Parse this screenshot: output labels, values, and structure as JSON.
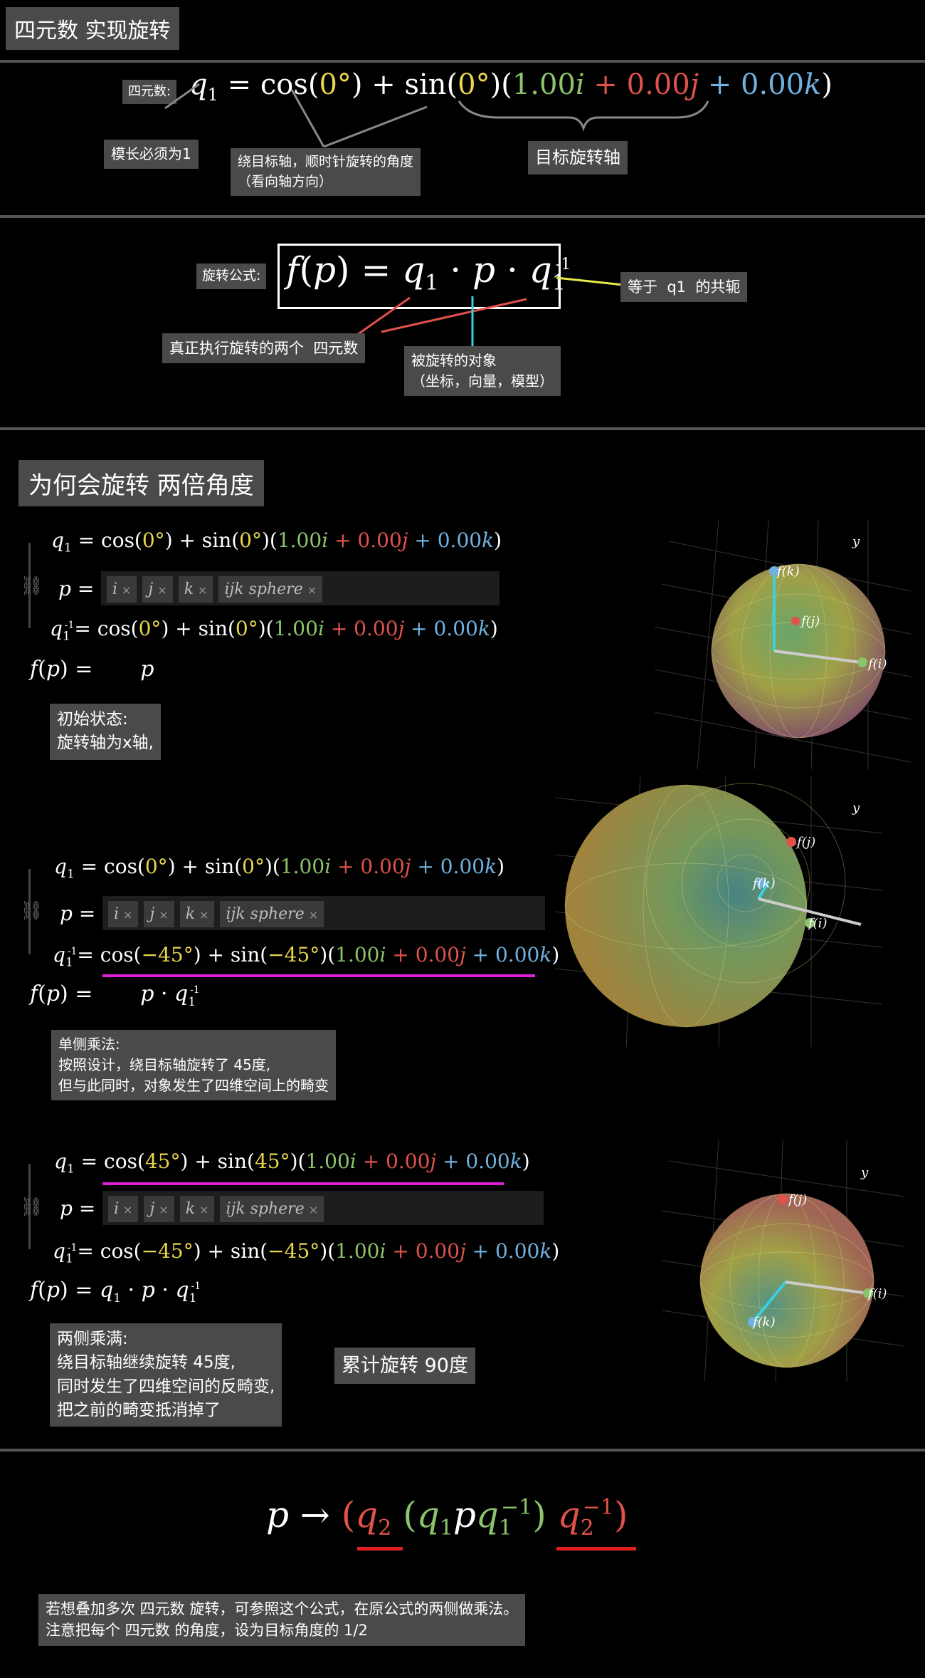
{
  "title": "四元数 实现旋转",
  "section1": {
    "prefix": "四元数:",
    "formula": {
      "q": "q",
      "sub": "1",
      "eq": "=",
      "cos": "cos",
      "angle": "0°",
      "plus": "+",
      "sin": "sin",
      "i": "1.00",
      "j": "0.00",
      "k": "0.00"
    },
    "note_unit": "模长必须为1",
    "note_angle": "绕目标轴，顺时针旋转的角度\n（看向轴方向）",
    "note_axis": "目标旋转轴"
  },
  "section2": {
    "prefix": "旋转公式:",
    "formula": "f(p) = q₁ · p · q₁⁻¹",
    "note_conj": "等于  q1  的共轭",
    "note_two": "真正执行旋转的两个  四元数",
    "note_obj": "被旋转的对象\n（坐标，向量，模型）"
  },
  "section3": {
    "title": "为何会旋转 两倍角度",
    "p_tags": [
      "i",
      "j",
      "k",
      "ijk sphere"
    ],
    "row1": {
      "q1": "q₁ = cos(0°) + sin(0°)(1.00i + 0.00j + 0.00k)",
      "qinv": "q₁⁻¹= cos(0°) + sin(0°)(1.00i + 0.00j + 0.00k)",
      "fp": "f(p) =        p",
      "note": "初始状态:\n旋转轴为x轴,",
      "sphere_labels": {
        "y": "y",
        "fk": "f(k)",
        "fj": "f(j)",
        "fi": "f(i)"
      }
    },
    "row2": {
      "q1": "q₁ = cos(0°) + sin(0°)(1.00i + 0.00j + 0.00k)",
      "qinv": "q₁⁻¹= cos(−45°) + sin(−45°)(1.00i + 0.00j + 0.00k)",
      "fp": "f(p) =        p · q₁⁻¹",
      "note": "单侧乘法:\n按照设计，绕目标轴旋转了 45度,\n但与此同时，对象发生了四维空间上的畸变",
      "sphere_labels": {
        "y": "y",
        "fk": "f(k)",
        "fj": "f(j)",
        "fi": "f(i)"
      }
    },
    "row3": {
      "q1": "q₁ = cos(45°) + sin(45°)(1.00i + 0.00j + 0.00k)",
      "qinv": "q₁⁻¹= cos(−45°) + sin(−45°)(1.00i + 0.00j + 0.00k)",
      "fp": "f(p) = q₁ · p · q₁⁻¹",
      "note": "两侧乘满:\n绕目标轴继续旋转 45度,\n同时发生了四维空间的反畸变,\n把之前的畸变抵消掉了",
      "total": "累计旋转 90度",
      "sphere_labels": {
        "y": "y",
        "fk": "f(k)",
        "fj": "f(j)",
        "fi": "f(i)"
      }
    }
  },
  "section4": {
    "formula": "p → (q₂ (q₁pq₁⁻¹) q₂⁻¹)",
    "note": "若想叠加多次 四元数 旋转，可参照这个公式，在原公式的两侧做乘法。\n注意把每个 四元数 的角度，设为目标角度的 1/2"
  }
}
